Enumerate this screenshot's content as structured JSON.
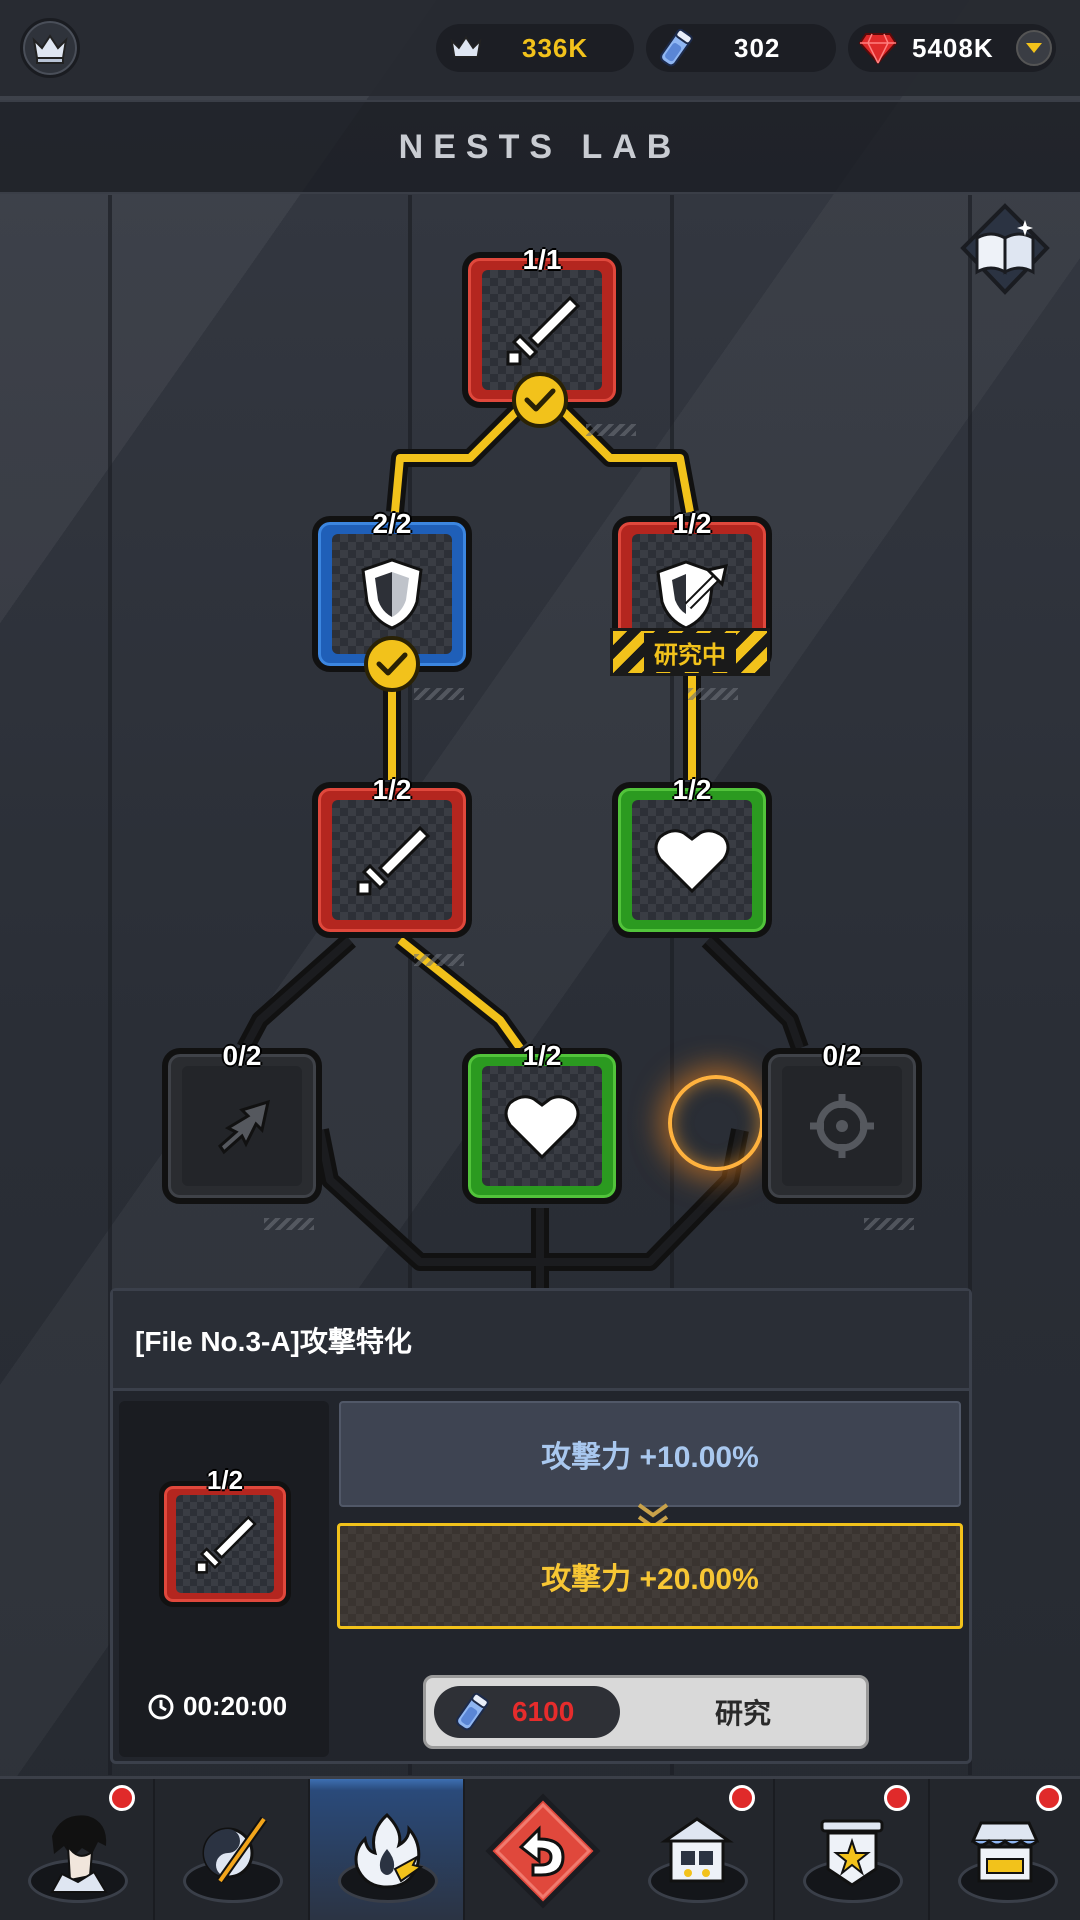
{
  "header": {
    "crowns_value": "336K",
    "tickets_value": "302",
    "gems_value": "5408K",
    "title": "NESTS LAB"
  },
  "tree": {
    "nodes": [
      {
        "count": "1/1",
        "color": "red",
        "icon": "sword-icon",
        "completed": true
      },
      {
        "count": "2/2",
        "color": "blue",
        "icon": "shield-icon",
        "completed": true
      },
      {
        "count": "1/2",
        "color": "red",
        "icon": "shield-arrow-icon",
        "status": "研究中"
      },
      {
        "count": "1/2",
        "color": "red",
        "icon": "sword-icon"
      },
      {
        "count": "1/2",
        "color": "green",
        "icon": "heart-icon"
      },
      {
        "count": "0/2",
        "color": "gray",
        "icon": "arrow-up-right-icon"
      },
      {
        "count": "1/2",
        "color": "green",
        "icon": "heart-icon"
      },
      {
        "count": "0/2",
        "color": "gray",
        "icon": "crosshair-icon"
      }
    ]
  },
  "detail": {
    "title": "[File No.3-A]攻撃特化",
    "node_count": "1/2",
    "timer": "00:20:00",
    "current_stat": "攻撃力 +10.00%",
    "next_stat": "攻撃力 +20.00%",
    "cost": "6100",
    "research_label": "研究"
  },
  "bottom_nav": {
    "items": [
      "character",
      "yin-yang-sword",
      "lab-fire",
      "back",
      "building",
      "rank-badge",
      "shop"
    ],
    "active": "lab-fire"
  },
  "colors": {
    "gold": "#f2c21b",
    "red_node": "#b4261f",
    "blue_node": "#1f5fb8",
    "green_node": "#2b9a20",
    "gem_red": "#e02a2a"
  }
}
